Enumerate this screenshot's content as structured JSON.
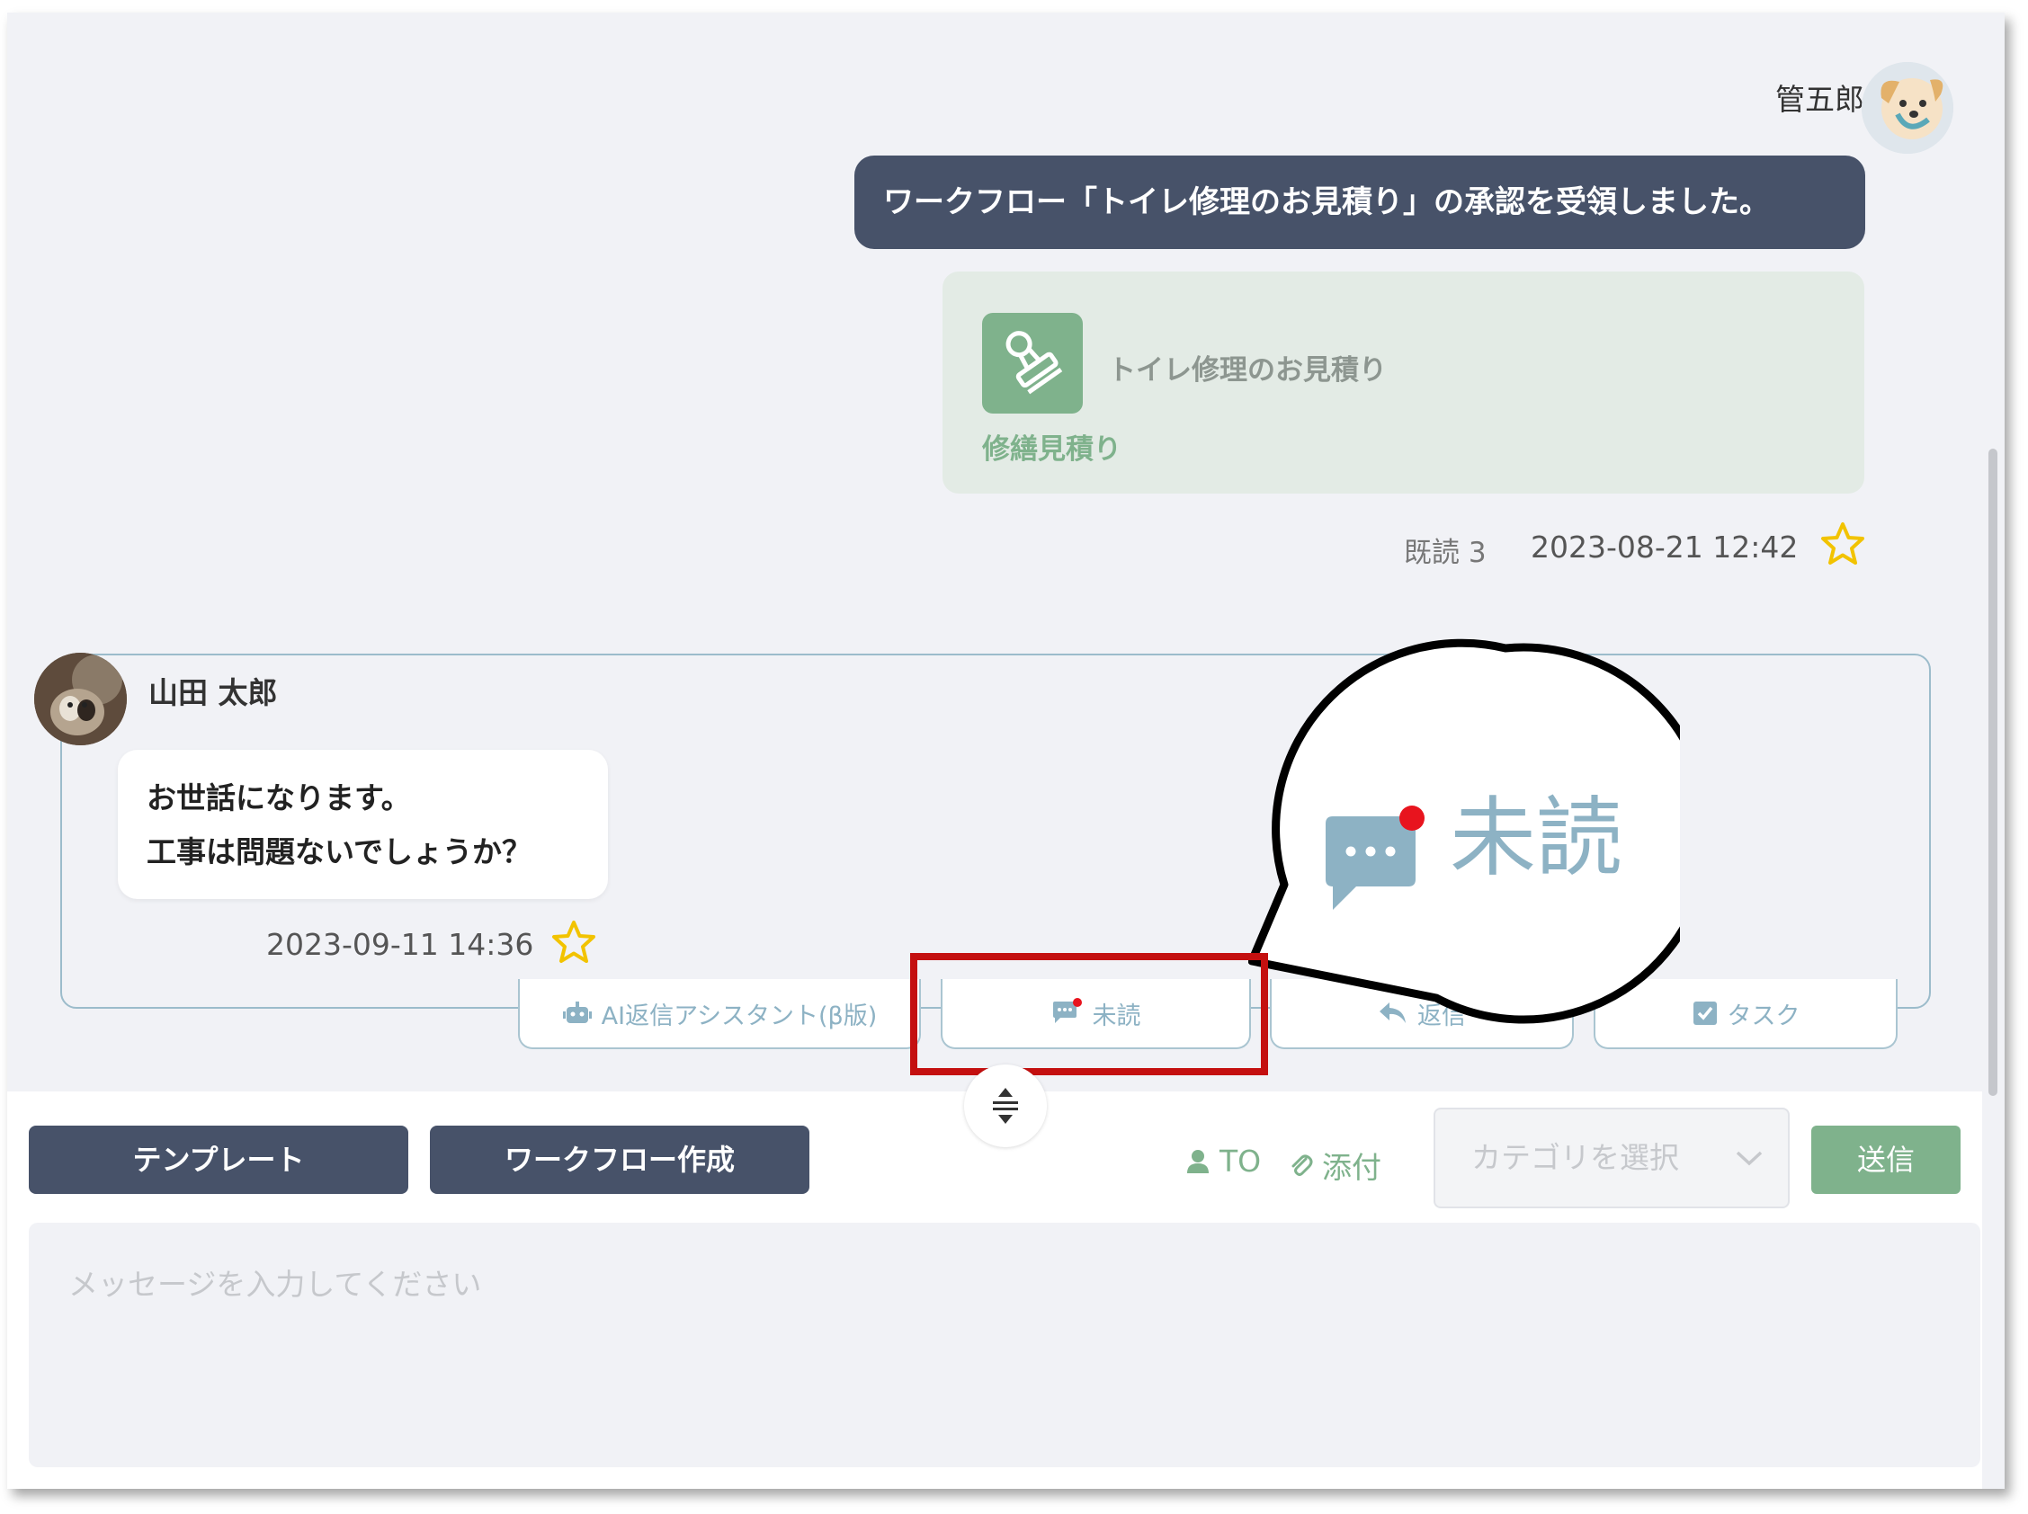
{
  "outgoing": {
    "sender_name": "管五郎",
    "message": "ワークフロー「トイレ修理のお見積り」の承認を受領しました。",
    "workflow_card": {
      "title": "トイレ修理のお見積り",
      "type": "修繕見積り"
    },
    "read_status": "既読 3",
    "timestamp": "2023-08-21 12:42"
  },
  "incoming": {
    "sender_name": "山田 太郎",
    "message_lines": [
      "お世話になります。",
      "工事は問題ないでしょうか？"
    ],
    "timestamp": "2023-09-11 14:36"
  },
  "actions": {
    "ai_reply_label": "AI返信アシスタント(β版)",
    "unread_label": "未読",
    "reply_label": "返信",
    "task_label": "タスク"
  },
  "callout": {
    "label": "未読"
  },
  "composer": {
    "template_label": "テンプレート",
    "workflow_create_label": "ワークフロー作成",
    "to_label": "TO",
    "attach_label": "添付",
    "category_placeholder": "カテゴリを選択",
    "send_label": "送信",
    "message_placeholder": "メッセージを入力してください"
  },
  "colors": {
    "navy": "#475269",
    "green": "#7fb28c",
    "light_blue": "#8db2c4",
    "highlight_red": "#c41010",
    "unread_dot": "#e8141e",
    "star": "#f2c300"
  }
}
